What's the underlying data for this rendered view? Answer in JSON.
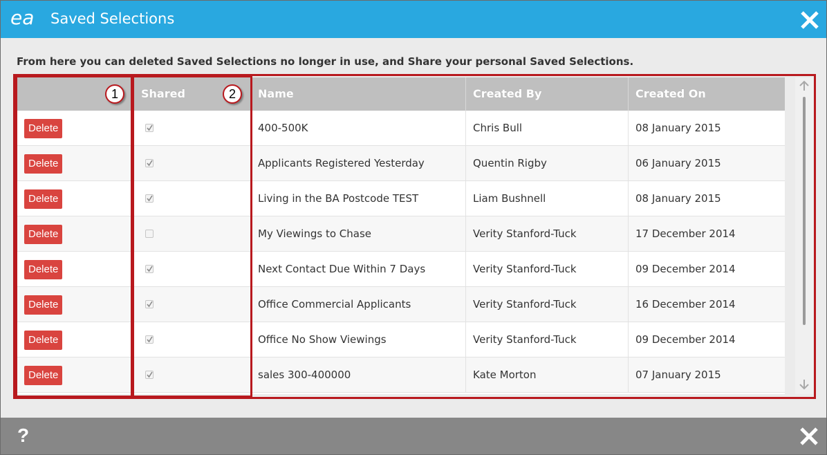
{
  "dialog": {
    "logo_text": "ea",
    "title": "Saved Selections",
    "close_icon": "close-icon",
    "intro": "From here you can deleted Saved Selections no longer in use, and Share your personal Saved Selections."
  },
  "table": {
    "columns": [
      "",
      "Shared",
      "Name",
      "Created By",
      "Created On"
    ],
    "delete_label": "Delete",
    "rows": [
      {
        "shared": true,
        "name": "400-500K",
        "created_by": "Chris Bull",
        "created_on": "08 January 2015"
      },
      {
        "shared": true,
        "name": "Applicants Registered Yesterday",
        "created_by": "Quentin Rigby",
        "created_on": "06 January 2015"
      },
      {
        "shared": true,
        "name": "Living in the BA Postcode TEST",
        "created_by": "Liam Bushnell",
        "created_on": "08 January 2015"
      },
      {
        "shared": false,
        "name": "My Viewings to Chase",
        "created_by": "Verity Stanford-Tuck",
        "created_on": "17 December 2014"
      },
      {
        "shared": true,
        "name": "Next Contact Due Within 7 Days",
        "created_by": "Verity Stanford-Tuck",
        "created_on": "09 December 2014"
      },
      {
        "shared": true,
        "name": "Office Commercial Applicants",
        "created_by": "Verity Stanford-Tuck",
        "created_on": "16 December 2014"
      },
      {
        "shared": true,
        "name": "Office No Show Viewings",
        "created_by": "Verity Stanford-Tuck",
        "created_on": "09 December 2014"
      },
      {
        "shared": true,
        "name": "sales 300-400000",
        "created_by": "Kate Morton",
        "created_on": "07 January 2015"
      }
    ]
  },
  "callouts": [
    "1",
    "2"
  ],
  "footer": {
    "help_label": "?",
    "close_icon": "close-icon"
  },
  "colors": {
    "title_bar": "#29a8e0",
    "delete_button": "#d9443f",
    "callout_border": "#b8191e",
    "footer": "#878787",
    "header": "#bfbfbf"
  }
}
